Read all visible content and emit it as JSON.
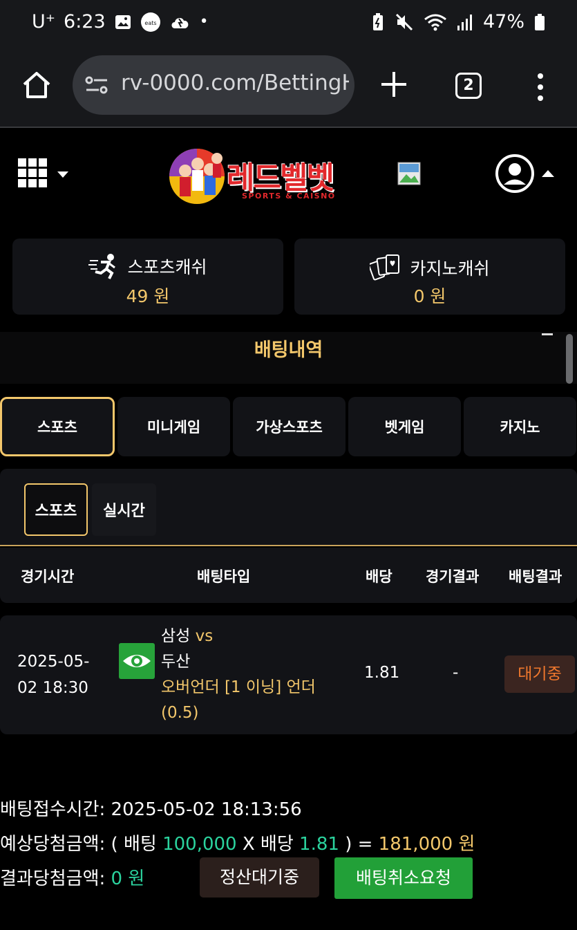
{
  "status_bar": {
    "carrier": "U⁺",
    "time": "6:23",
    "battery": "47%"
  },
  "browser": {
    "url": "rv-0000.com/BettingH",
    "tab_count": "2"
  },
  "site": {
    "logo_text": "레드벨벳",
    "logo_sub": "SPORTS & CAISNO"
  },
  "cash": {
    "sports_label": "스포츠캐쉬",
    "sports_amount": "49 원",
    "casino_label": "카지노캐쉬",
    "casino_amount": "0 원"
  },
  "section_title": "배팅내역",
  "main_tabs": [
    "스포츠",
    "미니게임",
    "가상스포츠",
    "벳게임",
    "카지노"
  ],
  "sub_tabs": [
    "스포츠",
    "실시간"
  ],
  "table": {
    "headers": [
      "경기시간",
      "배팅타입",
      "배당",
      "경기결과",
      "배팅결과"
    ],
    "row": {
      "date": "2025-05-02 18:30",
      "team_home": "삼성",
      "vs": "vs",
      "team_away": "두산",
      "bet_detail": "오버언더 [1 이닝] 언더 (0.5)",
      "odds": "1.81",
      "game_result": "-",
      "bet_result": "대기중"
    }
  },
  "summary": {
    "received_label": "배팅접수시간: ",
    "received_time": "2025-05-02 18:13:56",
    "expected_label": "예상당첨금액: ( 배팅 ",
    "bet_amount": "100,000",
    "x_label": " X 배당 ",
    "odds": "1.81",
    "close_eq": " ) = ",
    "expected_amount": "181,000 원",
    "result_label": "결과당첨금액: ",
    "result_amount": "0 원",
    "settle_button": "정산대기중",
    "cancel_button": "배팅취소요청"
  }
}
